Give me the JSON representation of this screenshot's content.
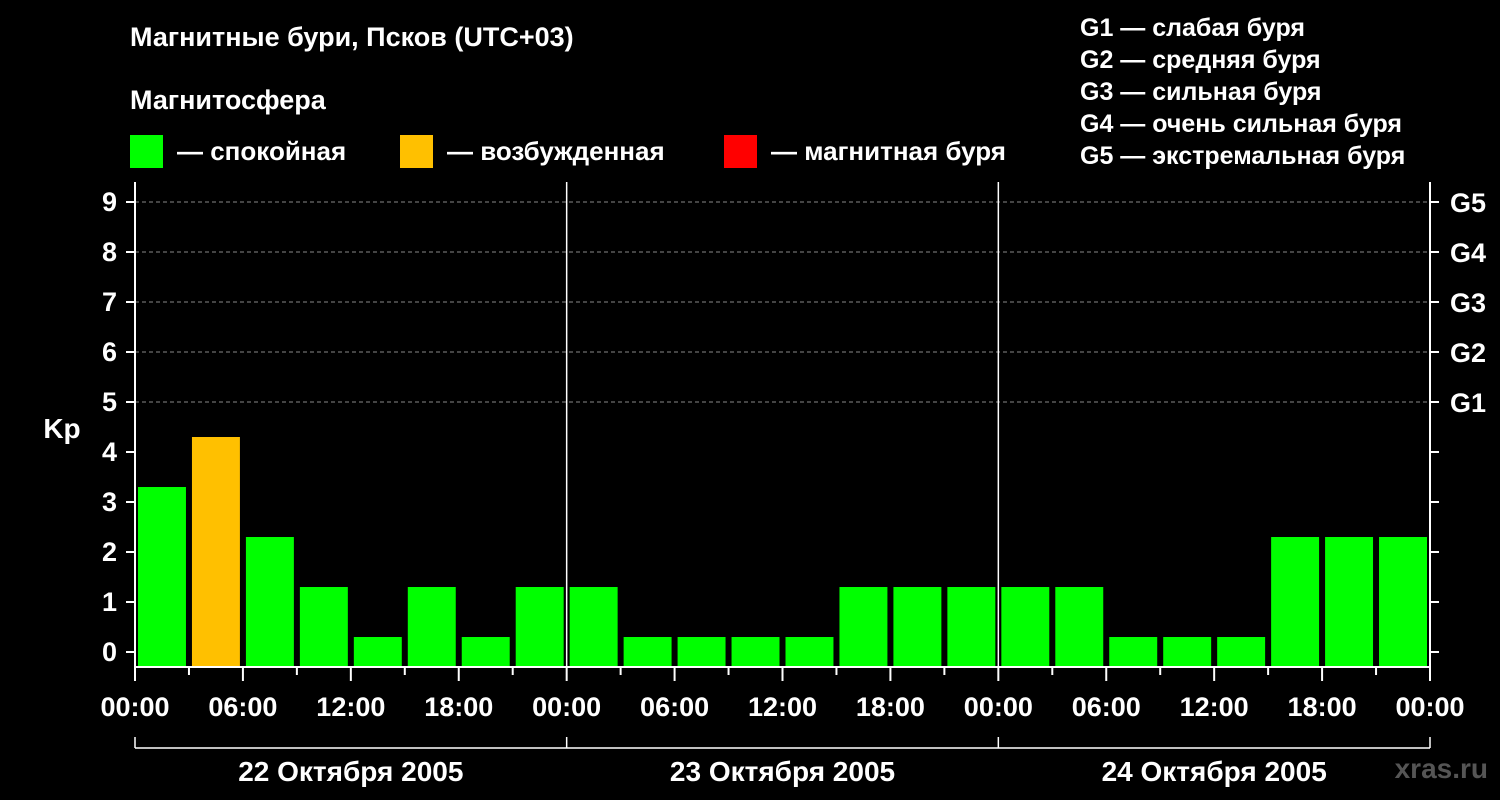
{
  "title": "Магнитные бури, Псков (UTC+03)",
  "subtitle": "Магнитосфера",
  "legend": [
    {
      "label": "— спокойная",
      "color": "#00ff00"
    },
    {
      "label": "— возбужденная",
      "color": "#ffc000"
    },
    {
      "label": "— магнитная буря",
      "color": "#ff0000"
    }
  ],
  "g_legend": [
    "G1 — слабая буря",
    "G2 — средняя буря",
    "G3 — сильная буря",
    "G4 — очень сильная буря",
    "G5 — экстремальная буря"
  ],
  "watermark": "xras.ru",
  "chart_data": {
    "type": "bar",
    "ylabel": "Kp",
    "ylim": [
      0,
      9
    ],
    "y_ticks": [
      "0",
      "1",
      "2",
      "3",
      "4",
      "5",
      "6",
      "7",
      "8",
      "9"
    ],
    "right_ticks": [
      {
        "kp": 5,
        "label": "G1"
      },
      {
        "kp": 6,
        "label": "G2"
      },
      {
        "kp": 7,
        "label": "G3"
      },
      {
        "kp": 8,
        "label": "G4"
      },
      {
        "kp": 9,
        "label": "G5"
      }
    ],
    "x_tick_labels": [
      "00:00",
      "06:00",
      "12:00",
      "18:00",
      "00:00",
      "06:00",
      "12:00",
      "18:00",
      "00:00",
      "06:00",
      "12:00",
      "18:00",
      "00:00"
    ],
    "days": [
      "22 Октября 2005",
      "23 Октября 2005",
      "24 Октября 2005"
    ],
    "interval_hours": 3,
    "values": [
      3,
      4,
      2,
      1,
      0,
      1,
      0,
      1,
      1,
      0,
      0,
      0,
      0,
      1,
      1,
      1,
      1,
      1,
      0,
      0,
      0,
      2,
      2,
      2
    ],
    "colors": {
      "quiet": "#00ff00",
      "active": "#ffc000",
      "storm": "#ff0000"
    },
    "grid": "dashed at Kp 5–9"
  }
}
